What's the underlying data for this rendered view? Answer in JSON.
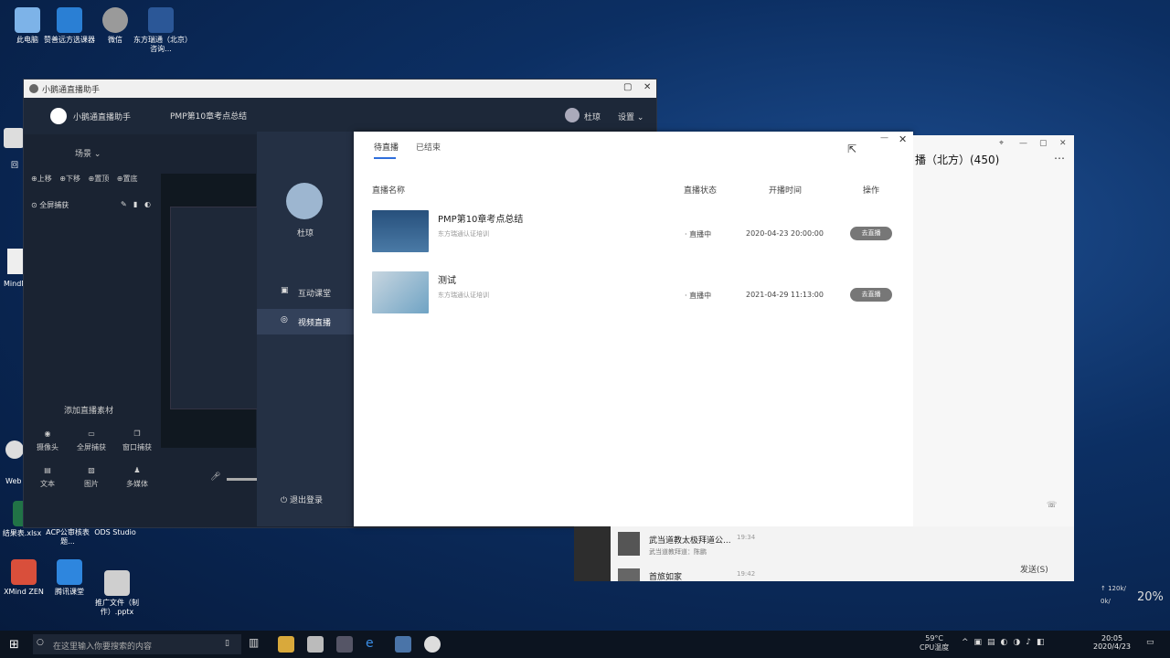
{
  "desktop": {
    "icons": [
      {
        "label": "此电脑",
        "icon": "computer-icon",
        "color": "#7db3e8"
      },
      {
        "label": "赞善远方选课器",
        "icon": "app-icon",
        "color": "#2a7fd4"
      },
      {
        "label": "微信",
        "icon": "wechat-icon",
        "color": "#8c8c8c"
      },
      {
        "label": "东方瑞通（北京）咨询...",
        "icon": "word-icon",
        "color": "#2b5797"
      },
      {
        "label": "结果表.xlsx",
        "icon": "excel-icon",
        "color": "#217346"
      },
      {
        "label": "ACP公审核表题...",
        "icon": "doc-icon",
        "color": "#ddd"
      },
      {
        "label": "ODS Studio",
        "icon": "ods-icon",
        "color": "#444"
      },
      {
        "label": "XMind ZEN",
        "icon": "xmind-icon",
        "color": "#d94f3b"
      },
      {
        "label": "腾讯课堂",
        "icon": "tencent-class-icon",
        "color": "#2e86de"
      },
      {
        "label": "推广文件（制作）.pptx",
        "icon": "ppt-icon",
        "color": "#cfcfcf"
      }
    ],
    "left_partial_labels": [
      "回",
      "MindM",
      "Web"
    ]
  },
  "back_window": {
    "title": "小鹅通直播助手",
    "app_name": "小鹅通直播助手",
    "live_title": "PMP第10章考点总结",
    "user": "杜琼",
    "settings_label": "设置",
    "scene_label": "场景",
    "toolbar": [
      "上移",
      "下移",
      "置顶",
      "置底"
    ],
    "source_item": "全屏捕获",
    "add_material_label": "添加直播素材",
    "materials": [
      {
        "label": "摄像头",
        "icon": "camera-icon"
      },
      {
        "label": "全屏捕获",
        "icon": "monitor-icon"
      },
      {
        "label": "窗口捕获",
        "icon": "window-icon"
      },
      {
        "label": "文本",
        "icon": "text-icon"
      },
      {
        "label": "图片",
        "icon": "image-icon"
      },
      {
        "label": "多媒体",
        "icon": "media-icon"
      }
    ]
  },
  "nav_panel": {
    "user": "杜琼",
    "items": [
      {
        "label": "互动课堂",
        "icon": "classroom-icon",
        "active": false
      },
      {
        "label": "视频直播",
        "icon": "live-icon",
        "active": true
      }
    ],
    "logout_label": "退出登录"
  },
  "dialog": {
    "tabs": [
      {
        "label": "待直播",
        "active": true
      },
      {
        "label": "已结束",
        "active": false
      }
    ],
    "columns": [
      "直播名称",
      "直播状态",
      "开播时间",
      "操作"
    ],
    "rows": [
      {
        "title": "PMP第10章考点总结",
        "org": "东方瑞通认证培训",
        "status": "直播中",
        "time": "2020-04-23 20:00:00",
        "action": "去直播",
        "thumb_color": "#2f5d8c"
      },
      {
        "title": "测试",
        "org": "东方瑞通认证培训",
        "status": "直播中",
        "time": "2021-04-29 11:13:00",
        "action": "去直播",
        "thumb_color": "#9fb9c9"
      }
    ]
  },
  "chat": {
    "title": "播（北方）(450)",
    "more_icon": "more-icon",
    "send_label": "发送(S)",
    "messages": [
      {
        "title": "武当道教太极拜道公...",
        "sub": "武当道教拜道：陈鹏",
        "time": "19:34"
      },
      {
        "title": "首旅如家",
        "sub": "",
        "time": "19:42"
      }
    ]
  },
  "taskbar": {
    "search_placeholder": "在这里输入你要搜索的内容",
    "temp": "59°C",
    "cpu_label": "CPU温度",
    "time": "20:05",
    "date": "2020/4/23",
    "speed_up": "↑ 120k/",
    "speed_down": "0k/",
    "percent": "20%"
  }
}
